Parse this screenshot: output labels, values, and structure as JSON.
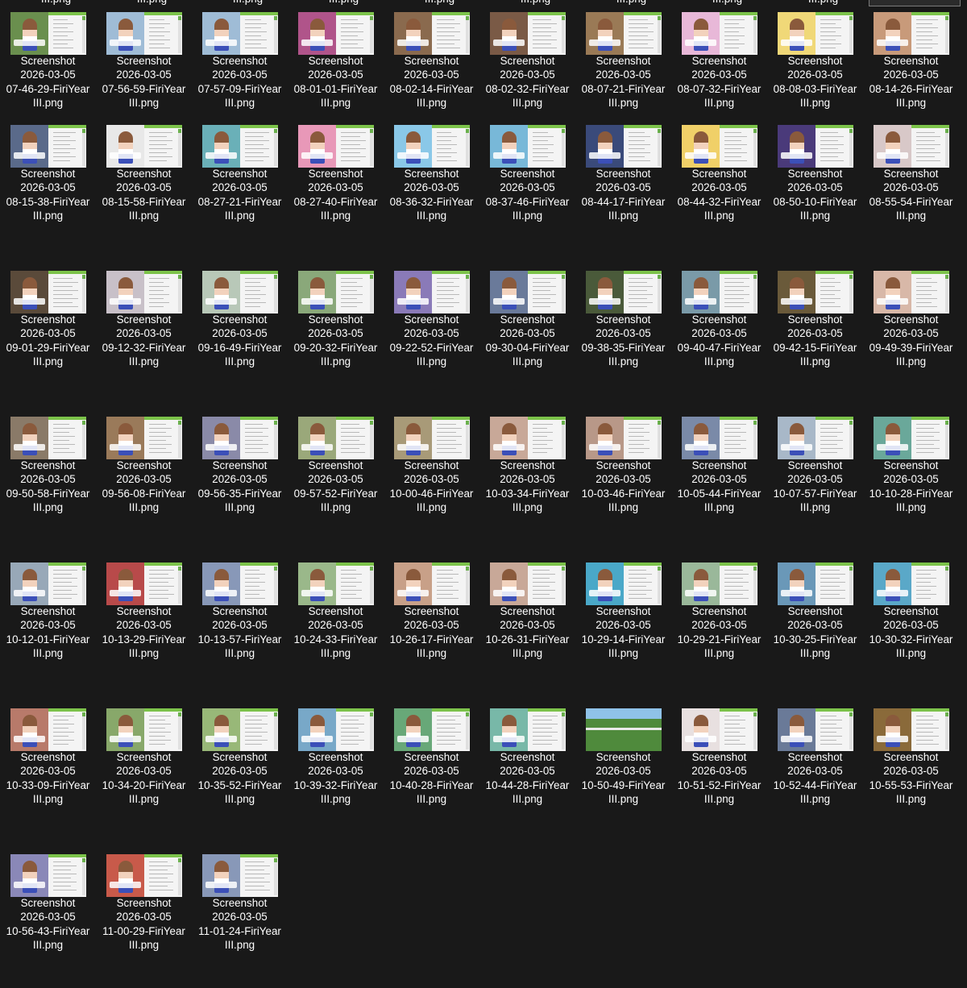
{
  "top_row_partial_label": "III.png",
  "colors": {
    "background": "#191919",
    "text": "#ffffff",
    "selection_border": "#7a7a7a"
  },
  "files": [
    {
      "line1": "Screenshot",
      "line2": "2026-03-05",
      "line3": "07-46-29-FiriYear",
      "line4": "III.png",
      "thumb": "#6a8f4e"
    },
    {
      "line1": "Screenshot",
      "line2": "2026-03-05",
      "line3": "07-56-59-FiriYear",
      "line4": "III.png",
      "thumb": "#9fbcd6"
    },
    {
      "line1": "Screenshot",
      "line2": "2026-03-05",
      "line3": "07-57-09-FiriYear",
      "line4": "III.png",
      "thumb": "#9fbcd6"
    },
    {
      "line1": "Screenshot",
      "line2": "2026-03-05",
      "line3": "08-01-01-FiriYear",
      "line4": "III.png",
      "thumb": "#b0548a"
    },
    {
      "line1": "Screenshot",
      "line2": "2026-03-05",
      "line3": "08-02-14-FiriYear",
      "line4": "III.png",
      "thumb": "#8a6a4e"
    },
    {
      "line1": "Screenshot",
      "line2": "2026-03-05",
      "line3": "08-02-32-FiriYear",
      "line4": "III.png",
      "thumb": "#7a5a46"
    },
    {
      "line1": "Screenshot",
      "line2": "2026-03-05",
      "line3": "08-07-21-FiriYear",
      "line4": "III.png",
      "thumb": "#9a7a56"
    },
    {
      "line1": "Screenshot",
      "line2": "2026-03-05",
      "line3": "08-07-32-FiriYear",
      "line4": "III.png",
      "thumb": "#e8b8d8"
    },
    {
      "line1": "Screenshot",
      "line2": "2026-03-05",
      "line3": "08-08-03-FiriYear",
      "line4": "III.png",
      "thumb": "#f0d878"
    },
    {
      "line1": "Screenshot",
      "line2": "2026-03-05",
      "line3": "08-14-26-FiriYear",
      "line4": "III.png",
      "thumb": "#c89a7a"
    },
    {
      "line1": "Screenshot",
      "line2": "2026-03-05",
      "line3": "08-15-38-FiriYear",
      "line4": "III.png",
      "thumb": "#5a6a8a"
    },
    {
      "line1": "Screenshot",
      "line2": "2026-03-05",
      "line3": "08-15-58-FiriYear",
      "line4": "III.png",
      "thumb": "#e8e8e8"
    },
    {
      "line1": "Screenshot",
      "line2": "2026-03-05",
      "line3": "08-27-21-FiriYear",
      "line4": "III.png",
      "thumb": "#6ab0b8"
    },
    {
      "line1": "Screenshot",
      "line2": "2026-03-05",
      "line3": "08-27-40-FiriYear",
      "line4": "III.png",
      "thumb": "#e898b8"
    },
    {
      "line1": "Screenshot",
      "line2": "2026-03-05",
      "line3": "08-36-32-FiriYear",
      "line4": "III.png",
      "thumb": "#8ac8e8"
    },
    {
      "line1": "Screenshot",
      "line2": "2026-03-05",
      "line3": "08-37-46-FiriYear",
      "line4": "III.png",
      "thumb": "#78b8d8"
    },
    {
      "line1": "Screenshot",
      "line2": "2026-03-05",
      "line3": "08-44-17-FiriYear",
      "line4": "III.png",
      "thumb": "#3a4a7a"
    },
    {
      "line1": "Screenshot",
      "line2": "2026-03-05",
      "line3": "08-44-32-FiriYear",
      "line4": "III.png",
      "thumb": "#f0d068"
    },
    {
      "line1": "Screenshot",
      "line2": "2026-03-05",
      "line3": "08-50-10-FiriYear",
      "line4": "III.png",
      "thumb": "#4a3a7a"
    },
    {
      "line1": "Screenshot",
      "line2": "2026-03-05",
      "line3": "08-55-54-FiriYear",
      "line4": "III.png",
      "thumb": "#d8c8c8"
    },
    {
      "line1": "Screenshot",
      "line2": "2026-03-05",
      "line3": "09-01-29-FiriYear",
      "line4": "III.png",
      "thumb": "#5a4a3a"
    },
    {
      "line1": "Screenshot",
      "line2": "2026-03-05",
      "line3": "09-12-32-FiriYear",
      "line4": "III.png",
      "thumb": "#c8c0c8"
    },
    {
      "line1": "Screenshot",
      "line2": "2026-03-05",
      "line3": "09-16-49-FiriYear",
      "line4": "III.png",
      "thumb": "#b8c8b8"
    },
    {
      "line1": "Screenshot",
      "line2": "2026-03-05",
      "line3": "09-20-32-FiriYear",
      "line4": "III.png",
      "thumb": "#8aa87a"
    },
    {
      "line1": "Screenshot",
      "line2": "2026-03-05",
      "line3": "09-22-52-FiriYear",
      "line4": "III.png",
      "thumb": "#8a7ab8"
    },
    {
      "line1": "Screenshot",
      "line2": "2026-03-05",
      "line3": "09-30-04-FiriYear",
      "line4": "III.png",
      "thumb": "#6a7a9a"
    },
    {
      "line1": "Screenshot",
      "line2": "2026-03-05",
      "line3": "09-38-35-FiriYear",
      "line4": "III.png",
      "thumb": "#4a5a3a"
    },
    {
      "line1": "Screenshot",
      "line2": "2026-03-05",
      "line3": "09-40-47-FiriYear",
      "line4": "III.png",
      "thumb": "#7a9aa8"
    },
    {
      "line1": "Screenshot",
      "line2": "2026-03-05",
      "line3": "09-42-15-FiriYear",
      "line4": "III.png",
      "thumb": "#6a5a3a"
    },
    {
      "line1": "Screenshot",
      "line2": "2026-03-05",
      "line3": "09-49-39-FiriYear",
      "line4": "III.png",
      "thumb": "#d8b8a8"
    },
    {
      "line1": "Screenshot",
      "line2": "2026-03-05",
      "line3": "09-50-58-FiriYear",
      "line4": "III.png",
      "thumb": "#8a7a68"
    },
    {
      "line1": "Screenshot",
      "line2": "2026-03-05",
      "line3": "09-56-08-FiriYear",
      "line4": "III.png",
      "thumb": "#9a7a5a"
    },
    {
      "line1": "Screenshot",
      "line2": "2026-03-05",
      "line3": "09-56-35-FiriYear",
      "line4": "III.png",
      "thumb": "#8a8aa8"
    },
    {
      "line1": "Screenshot",
      "line2": "2026-03-05",
      "line3": "09-57-52-FiriYear",
      "line4": "III.png",
      "thumb": "#9aa87a"
    },
    {
      "line1": "Screenshot",
      "line2": "2026-03-05",
      "line3": "10-00-46-FiriYear",
      "line4": "III.png",
      "thumb": "#a89a78"
    },
    {
      "line1": "Screenshot",
      "line2": "2026-03-05",
      "line3": "10-03-34-FiriYear",
      "line4": "III.png",
      "thumb": "#c8a898"
    },
    {
      "line1": "Screenshot",
      "line2": "2026-03-05",
      "line3": "10-03-46-FiriYear",
      "line4": "III.png",
      "thumb": "#b89888"
    },
    {
      "line1": "Screenshot",
      "line2": "2026-03-05",
      "line3": "10-05-44-FiriYear",
      "line4": "III.png",
      "thumb": "#7a8aa8"
    },
    {
      "line1": "Screenshot",
      "line2": "2026-03-05",
      "line3": "10-07-57-FiriYear",
      "line4": "III.png",
      "thumb": "#a8b8c8"
    },
    {
      "line1": "Screenshot",
      "line2": "2026-03-05",
      "line3": "10-10-28-FiriYear",
      "line4": "III.png",
      "thumb": "#6aa89a"
    },
    {
      "line1": "Screenshot",
      "line2": "2026-03-05",
      "line3": "10-12-01-FiriYear",
      "line4": "III.png",
      "thumb": "#98a8b8"
    },
    {
      "line1": "Screenshot",
      "line2": "2026-03-05",
      "line3": "10-13-29-FiriYear",
      "line4": "III.png",
      "thumb": "#b84a4a"
    },
    {
      "line1": "Screenshot",
      "line2": "2026-03-05",
      "line3": "10-13-57-FiriYear",
      "line4": "III.png",
      "thumb": "#8898b8"
    },
    {
      "line1": "Screenshot",
      "line2": "2026-03-05",
      "line3": "10-24-33-FiriYear",
      "line4": "III.png",
      "thumb": "#9ab88a"
    },
    {
      "line1": "Screenshot",
      "line2": "2026-03-05",
      "line3": "10-26-17-FiriYear",
      "line4": "III.png",
      "thumb": "#c8a088"
    },
    {
      "line1": "Screenshot",
      "line2": "2026-03-05",
      "line3": "10-26-31-FiriYear",
      "line4": "III.png",
      "thumb": "#c8a898"
    },
    {
      "line1": "Screenshot",
      "line2": "2026-03-05",
      "line3": "10-29-14-FiriYear",
      "line4": "III.png",
      "thumb": "#4aa8c8"
    },
    {
      "line1": "Screenshot",
      "line2": "2026-03-05",
      "line3": "10-29-21-FiriYear",
      "line4": "III.png",
      "thumb": "#9ab89a"
    },
    {
      "line1": "Screenshot",
      "line2": "2026-03-05",
      "line3": "10-30-25-FiriYear",
      "line4": "III.png",
      "thumb": "#6a98b8"
    },
    {
      "line1": "Screenshot",
      "line2": "2026-03-05",
      "line3": "10-30-32-FiriYear",
      "line4": "III.png",
      "thumb": "#5aa8c8"
    },
    {
      "line1": "Screenshot",
      "line2": "2026-03-05",
      "line3": "10-33-09-FiriYear",
      "line4": "III.png",
      "thumb": "#b87a6a"
    },
    {
      "line1": "Screenshot",
      "line2": "2026-03-05",
      "line3": "10-34-20-FiriYear",
      "line4": "III.png",
      "thumb": "#88a86a"
    },
    {
      "line1": "Screenshot",
      "line2": "2026-03-05",
      "line3": "10-35-52-FiriYear",
      "line4": "III.png",
      "thumb": "#98b878"
    },
    {
      "line1": "Screenshot",
      "line2": "2026-03-05",
      "line3": "10-39-32-FiriYear",
      "line4": "III.png",
      "thumb": "#78a8c8"
    },
    {
      "line1": "Screenshot",
      "line2": "2026-03-05",
      "line3": "10-40-28-FiriYear",
      "line4": "III.png",
      "thumb": "#68a878"
    },
    {
      "line1": "Screenshot",
      "line2": "2026-03-05",
      "line3": "10-44-28-FiriYear",
      "line4": "III.png",
      "thumb": "#78b8a8"
    },
    {
      "line1": "Screenshot",
      "line2": "2026-03-05",
      "line3": "10-50-49-FiriYear",
      "line4": "III.png",
      "thumb": "#5a8a3a",
      "race": true
    },
    {
      "line1": "Screenshot",
      "line2": "2026-03-05",
      "line3": "10-51-52-FiriYear",
      "line4": "III.png",
      "thumb": "#e8e0e0"
    },
    {
      "line1": "Screenshot",
      "line2": "2026-03-05",
      "line3": "10-52-44-FiriYear",
      "line4": "III.png",
      "thumb": "#6a7a98"
    },
    {
      "line1": "Screenshot",
      "line2": "2026-03-05",
      "line3": "10-55-53-FiriYear",
      "line4": "III.png",
      "thumb": "#8a6a3a"
    },
    {
      "line1": "Screenshot",
      "line2": "2026-03-05",
      "line3": "10-56-43-FiriYear",
      "line4": "III.png",
      "thumb": "#8a88b8"
    },
    {
      "line1": "Screenshot",
      "line2": "2026-03-05",
      "line3": "11-00-29-FiriYear",
      "line4": "III.png",
      "thumb": "#c85a4a"
    },
    {
      "line1": "Screenshot",
      "line2": "2026-03-05",
      "line3": "11-01-24-FiriYear",
      "line4": "III.png",
      "thumb": "#8898b8"
    }
  ]
}
